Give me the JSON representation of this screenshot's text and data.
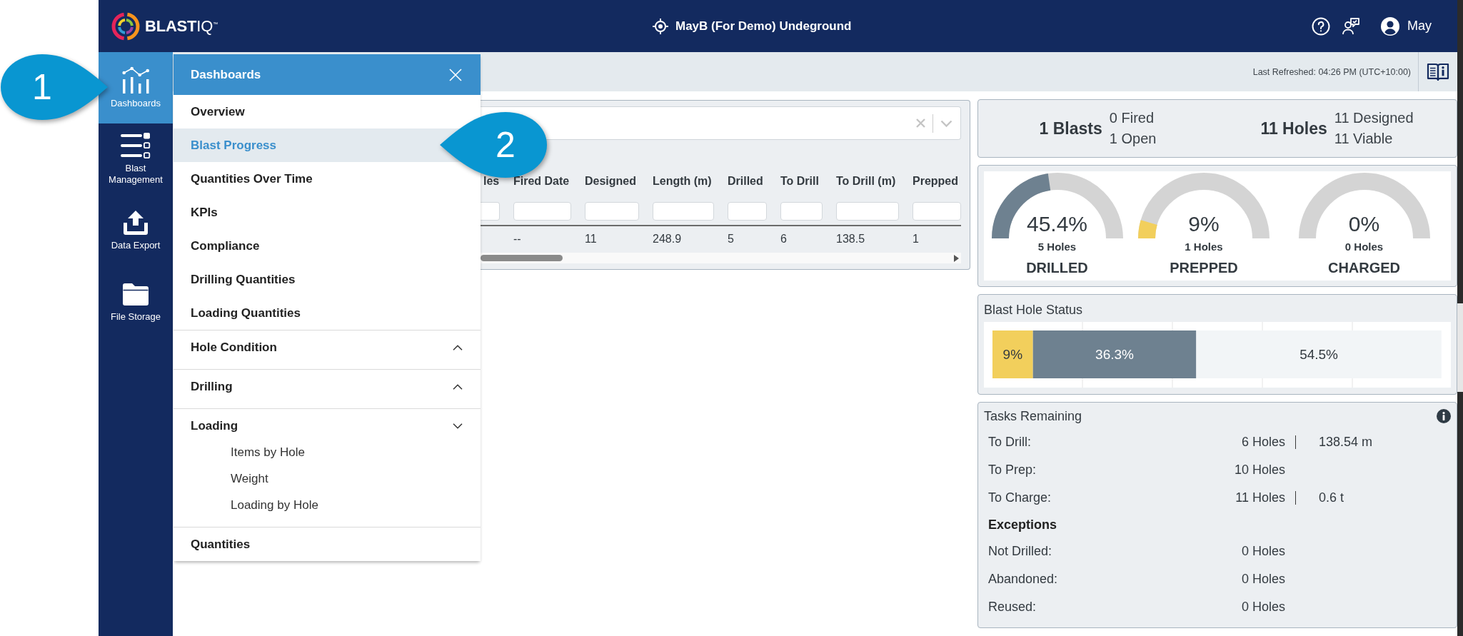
{
  "header": {
    "logo": "**BLAST**IQ$^{™}$",
    "site": "MayB (For Demo) Undeground",
    "user": "May"
  },
  "sidebar": {
    "items": [
      {
        "label": "Dashboards",
        "selected": true
      },
      {
        "label": "Blast Management",
        "selected": false
      },
      {
        "label": "Data Export",
        "selected": false
      },
      {
        "label": "File Storage",
        "selected": false
      }
    ]
  },
  "toolbar": {
    "last_refreshed": "Last Refreshed: 04:26 PM (UTC+10:00)"
  },
  "menu": {
    "title": "Dashboards",
    "sections": [
      {
        "items": [
          {
            "kind": "link",
            "label": "Overview",
            "selected": false
          },
          {
            "kind": "link",
            "label": "Blast Progress",
            "selected": true
          },
          {
            "kind": "link",
            "label": "Quantities Over Time",
            "selected": false
          },
          {
            "kind": "link",
            "label": "KPIs",
            "selected": false
          },
          {
            "kind": "link",
            "label": "Compliance",
            "selected": false
          },
          {
            "kind": "link",
            "label": "Drilling Quantities",
            "selected": false
          },
          {
            "kind": "link",
            "label": "Loading Quantities",
            "selected": false
          }
        ]
      },
      {
        "items": [
          {
            "kind": "group",
            "label": "Hole Condition",
            "expanded": false
          }
        ]
      },
      {
        "items": [
          {
            "kind": "group",
            "label": "Drilling",
            "expanded": false
          }
        ]
      },
      {
        "items": [
          {
            "kind": "group",
            "label": "Loading",
            "expanded": true,
            "children": [
              {
                "label": "Items by Hole",
                "selected": false
              },
              {
                "label": "Weight",
                "selected": false
              },
              {
                "label": "Loading by Hole",
                "selected": false
              }
            ]
          }
        ]
      },
      {
        "items": [
          {
            "kind": "link",
            "label": "Quantities",
            "selected": false
          }
        ]
      }
    ]
  },
  "blasts_table": {
    "columns": [
      {
        "label": "les"
      },
      {
        "label": "Fired Date"
      },
      {
        "label": "Designed"
      },
      {
        "label": "Length (m)"
      },
      {
        "label": "Drilled"
      },
      {
        "label": "To Drill"
      },
      {
        "label": "To Drill (m)"
      },
      {
        "label": "Prepped"
      }
    ],
    "rows": [
      {
        "cells": [
          null,
          "--",
          "11",
          "248.9",
          "5",
          "6",
          "138.5",
          "1"
        ]
      }
    ]
  },
  "summary": [
    {
      "total": "1 Blasts",
      "details": [
        "0 Fired",
        "1 Open"
      ]
    },
    {
      "total": "11 Holes",
      "details": [
        "11 Designed",
        "11 Viable"
      ]
    }
  ],
  "gauges": [
    {
      "reading": "45.4%",
      "level": 0.454,
      "holes": "5 Holes",
      "label": "DRILLED",
      "color": "#6e8190"
    },
    {
      "reading": "9%",
      "level": 0.09,
      "holes": "1 Holes",
      "label": "PREPPED",
      "color": "#f2cf5c"
    },
    {
      "reading": "0%",
      "holes": "0 Holes",
      "label": "CHARGED"
    }
  ],
  "hole_status": {
    "title": "Blast Hole Status",
    "chart_data": {
      "type": "bar",
      "orientation": "horizontal",
      "stacked": true,
      "series": [
        {
          "color": "#f2cf5c",
          "values": [
            9
          ],
          "value_labels": [
            "9%"
          ]
        },
        {
          "color": "#6e8190",
          "values": [
            36.3
          ],
          "value_labels": [
            "36.3%"
          ]
        },
        {
          "color": "#f2f5f7",
          "values": [
            54.5
          ],
          "value_labels": [
            "54.5%"
          ]
        }
      ]
    }
  },
  "tasks": {
    "title": "Tasks Remaining",
    "rows": [
      {
        "kind": "row",
        "label": "To Drill:",
        "value": "6 Holes",
        "extra": "138.54 m"
      },
      {
        "kind": "row",
        "label": "To Prep:",
        "value": "10 Holes"
      },
      {
        "kind": "row",
        "label": "To Charge:",
        "value": "11 Holes",
        "extra": "0.6 t"
      },
      {
        "kind": "heading",
        "label": "Exceptions"
      },
      {
        "kind": "row",
        "label": "Not Drilled:",
        "value": "0 Holes"
      },
      {
        "kind": "row",
        "label": "Abandoned:",
        "value": "0 Holes"
      },
      {
        "kind": "row",
        "label": "Reused:",
        "value": "0 Holes"
      }
    ]
  },
  "annotations": [
    {
      "label": "1"
    },
    {
      "label": "2"
    }
  ]
}
